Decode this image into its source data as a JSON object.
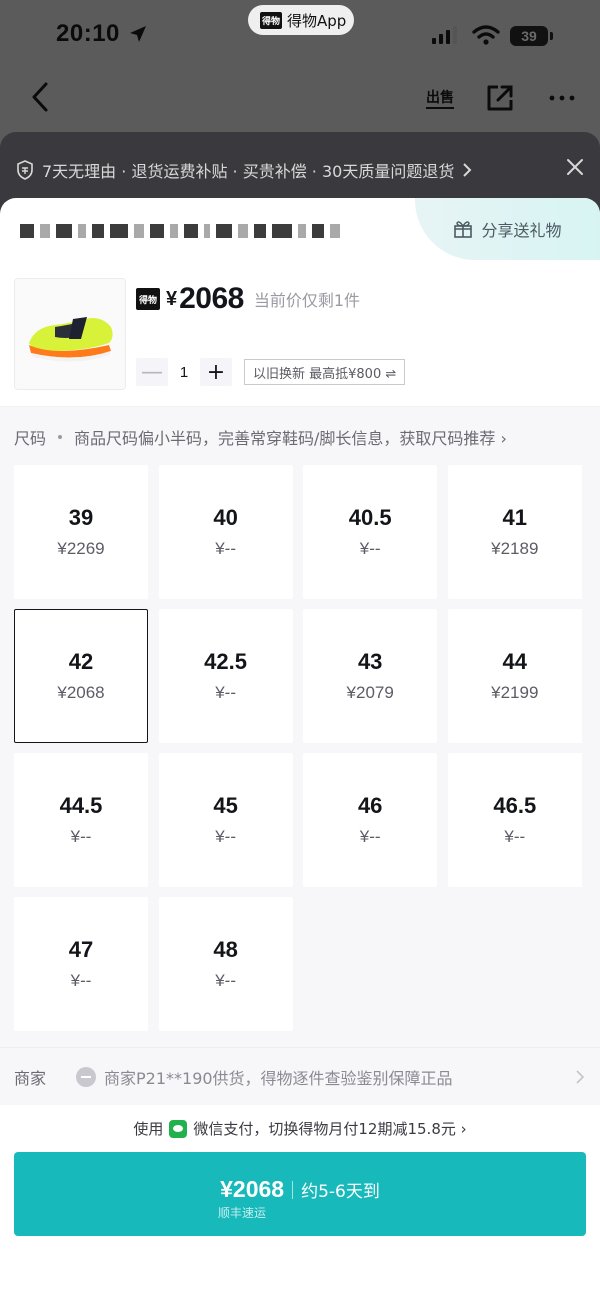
{
  "status": {
    "time": "20:10",
    "app_name": "得物App",
    "app_logo": "得物",
    "battery": "39"
  },
  "nav": {
    "sell_label": "出售"
  },
  "banner": {
    "text": "7天无理由 · 退货运费补贴 · 买贵补偿 · 30天质量问题退货"
  },
  "share": {
    "label": "分享送礼物"
  },
  "product": {
    "badge": "得物",
    "currency": "¥",
    "price": "2068",
    "stock_note": "当前价仅剩1件",
    "quantity": "1",
    "minus": "—",
    "plus": "+",
    "tradein": "以旧换新 最高抵¥800 ⇌"
  },
  "size_hint": {
    "label": "尺码",
    "text": "商品尺码偏小半码，完善常穿鞋码/脚长信息，获取尺码推荐 ›"
  },
  "sizes": [
    {
      "size": "39",
      "price": "¥2269"
    },
    {
      "size": "40",
      "price": "¥--"
    },
    {
      "size": "40.5",
      "price": "¥--"
    },
    {
      "size": "41",
      "price": "¥2189"
    },
    {
      "size": "42",
      "price": "¥2068",
      "selected": true
    },
    {
      "size": "42.5",
      "price": "¥--"
    },
    {
      "size": "43",
      "price": "¥2079"
    },
    {
      "size": "44",
      "price": "¥2199"
    },
    {
      "size": "44.5",
      "price": "¥--"
    },
    {
      "size": "45",
      "price": "¥--"
    },
    {
      "size": "46",
      "price": "¥--"
    },
    {
      "size": "46.5",
      "price": "¥--"
    },
    {
      "size": "47",
      "price": "¥--"
    },
    {
      "size": "48",
      "price": "¥--"
    }
  ],
  "seller": {
    "label": "商家",
    "text": "商家P21**190供货，得物逐件查验鉴别保障正品"
  },
  "payment": {
    "prefix": "使用",
    "text": "微信支付，切换得物月付12期减15.8元 ›"
  },
  "buy": {
    "price": "¥2068",
    "eta": "约5-6天到",
    "shipping": "顺丰速运"
  },
  "colors": {
    "accent": "#18b9bb",
    "selected_border": "#14151a"
  }
}
